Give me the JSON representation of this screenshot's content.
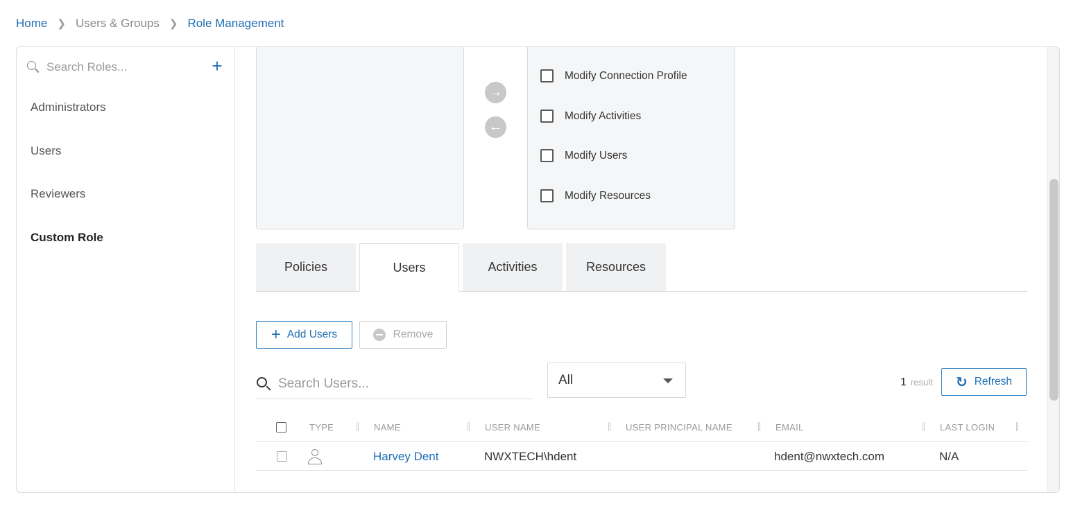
{
  "breadcrumb": {
    "home": "Home",
    "section": "Users & Groups",
    "current": "Role Management"
  },
  "sidebar": {
    "search_placeholder": "Search Roles...",
    "add_label": "+",
    "roles": [
      "Administrators",
      "Users",
      "Reviewers",
      "Custom Role"
    ],
    "active_role": "Custom Role"
  },
  "permissions": {
    "move_right_icon": "arrow-right-icon",
    "move_left_icon": "arrow-left-icon",
    "items": [
      "Modify Connection Profile",
      "Modify Activities",
      "Modify Users",
      "Modify Resources"
    ]
  },
  "tabs": [
    "Policies",
    "Users",
    "Activities",
    "Resources"
  ],
  "active_tab": "Users",
  "toolbar": {
    "add_users": "Add Users",
    "remove": "Remove",
    "refresh": "Refresh"
  },
  "search": {
    "placeholder": "Search Users...",
    "filter_value": "All"
  },
  "results": {
    "count": "1",
    "label": "result"
  },
  "table": {
    "columns": [
      "TYPE",
      "NAME",
      "USER NAME",
      "USER PRINCIPAL NAME",
      "EMAIL",
      "LAST LOGIN"
    ],
    "rows": [
      {
        "type_icon": "user-icon",
        "name": "Harvey Dent",
        "user_name": "NWXTECH\\hdent",
        "upn": "",
        "email": "hdent@nwxtech.com",
        "last_login": "N/A"
      }
    ]
  },
  "colors": {
    "accent": "#1f6fb5",
    "pane_bg": "#f5f6f7",
    "muted": "#9a9a9a"
  }
}
